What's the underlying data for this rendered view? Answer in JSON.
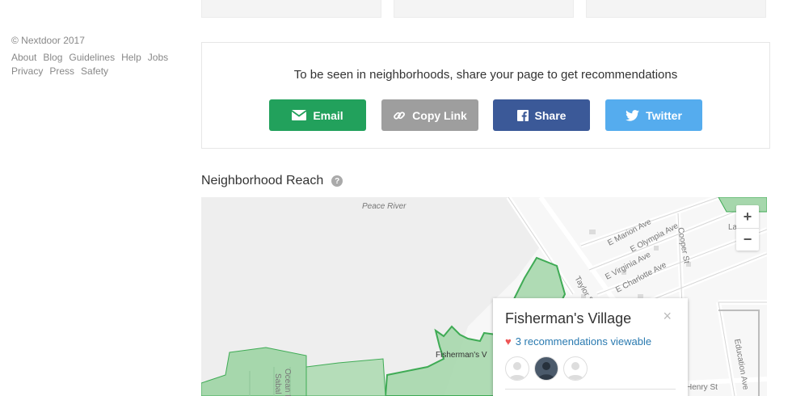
{
  "footer": {
    "copyright": "© Nextdoor 2017",
    "links": [
      "About",
      "Blog",
      "Guidelines",
      "Help",
      "Jobs",
      "Privacy",
      "Press",
      "Safety"
    ]
  },
  "share": {
    "title": "To be seen in neighborhoods, share your page to get recommendations",
    "email": "Email",
    "copy_link": "Copy Link",
    "facebook": "Share",
    "twitter": "Twitter"
  },
  "reach": {
    "title": "Neighborhood Reach",
    "help": "?"
  },
  "map": {
    "labels": {
      "peace_river": "Peace River",
      "marion": "E Marion Ave",
      "olympia": "E Olympia Ave",
      "virginia": "E Virginia Ave",
      "charlotte": "E Charlotte Ave",
      "taylor": "Taylor St",
      "cooper": "Cooper St",
      "education": "Education Ave",
      "henry": "Henry St",
      "ocean": "Ocean Dr",
      "sabal": "Sabal Dr",
      "fishermans_short": "Fisherman's V",
      "edge_rd": "La   Rd"
    },
    "zoom_in": "+",
    "zoom_out": "−"
  },
  "popup": {
    "title": "Fisherman's Village",
    "close": "×",
    "recommendations": "3 recommendations viewable"
  },
  "colors": {
    "email": "#22a15c",
    "copy": "#9e9e9e",
    "facebook": "#3b5998",
    "twitter": "#55acee",
    "green_fill": "#a6d7ac",
    "green_stroke": "#3fab55"
  }
}
